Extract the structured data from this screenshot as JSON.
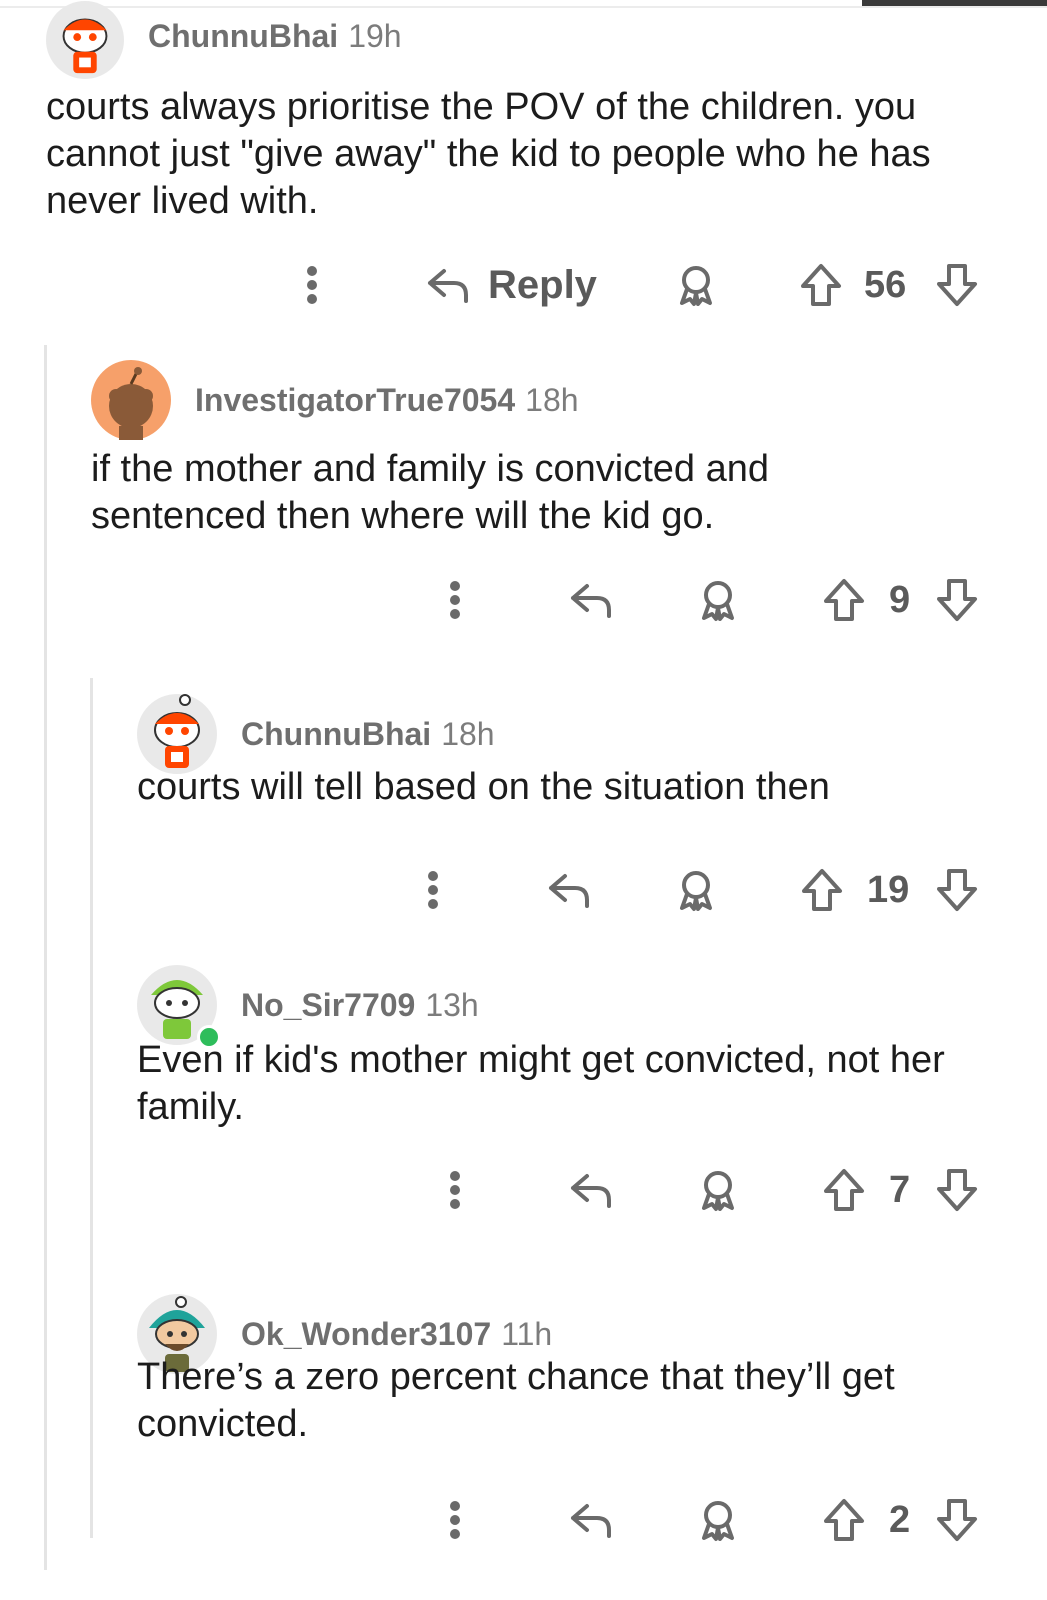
{
  "comments": [
    {
      "username": "ChunnuBhai",
      "time": "19h",
      "avatar_icon": "snoo-avatar-orange-cap",
      "lines": [
        "courts always prioritise the POV of the children. you",
        "cannot just \"give away\" the kid to people who he has",
        "never lived with."
      ],
      "reply_label": "Reply",
      "votes": "56"
    },
    {
      "username": "InvestigatorTrue7054",
      "time": "18h",
      "avatar_icon": "snoo-avatar-default-orange",
      "lines": [
        "if the mother and family is convicted and",
        "sentenced then where will the kid go."
      ],
      "votes": "9"
    },
    {
      "username": "ChunnuBhai",
      "time": "18h",
      "avatar_icon": "snoo-avatar-orange-cap",
      "lines": [
        "courts will tell based on the situation then"
      ],
      "votes": "19"
    },
    {
      "username": "No_Sir7709",
      "time": "13h",
      "avatar_icon": "snoo-avatar-green-cap",
      "online": true,
      "lines": [
        "Even if kid's mother might get convicted, not her",
        "family."
      ],
      "votes": "7"
    },
    {
      "username": "Ok_Wonder3107",
      "time": "11h",
      "avatar_icon": "snoo-avatar-teal-turban",
      "lines": [
        "There’s a zero percent chance that they’ll get",
        "convicted."
      ],
      "votes": "2"
    }
  ],
  "colors": {
    "text": "#1c1c1c",
    "meta": "#7c7c7c",
    "icon": "#6a6a6a",
    "thread_line": "#e4e4e4",
    "online": "#2ebd5b"
  }
}
